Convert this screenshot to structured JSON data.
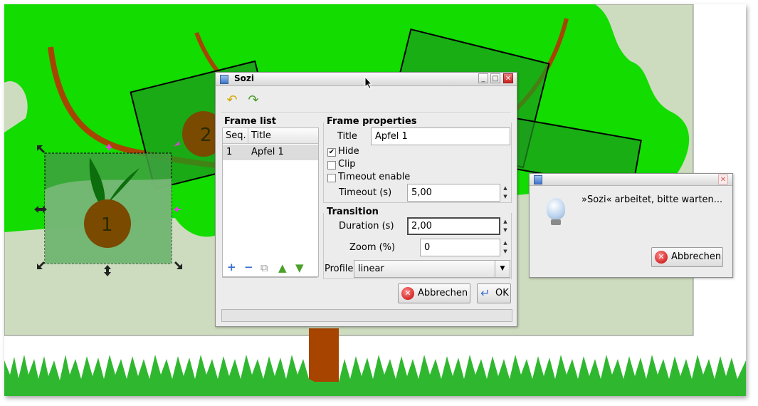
{
  "scene": {
    "frame_numbers": [
      "1",
      "2"
    ]
  },
  "sozi": {
    "title": "Sozi",
    "win_minimize": "_",
    "win_maximize": "□",
    "win_close": "✕",
    "toolbar": {
      "undo_icon": "↶",
      "redo_icon": "↷"
    },
    "frame_list": {
      "title": "Frame list",
      "col_seq": "Seq.",
      "col_title": "Title",
      "rows": [
        {
          "seq": "1",
          "title": "Apfel 1"
        }
      ],
      "add": "+",
      "remove": "−",
      "duplicate": "⧉",
      "up": "▲",
      "down": "▼"
    },
    "frame_properties": {
      "title": "Frame properties",
      "title_label": "Title",
      "title_value": "Apfel 1",
      "hide_label": "Hide",
      "hide_checked": "✔",
      "clip_label": "Clip",
      "timeout_enable_label": "Timeout enable",
      "timeout_label": "Timeout (s)",
      "timeout_value": "5,00"
    },
    "transition": {
      "title": "Transition",
      "duration_label": "Duration (s)",
      "duration_value": "2,00",
      "zoom_label": "Zoom (%)",
      "zoom_value": "0",
      "profile_label": "Profile",
      "profile_value": "linear"
    },
    "cancel_label": "Abbrechen",
    "ok_label": "OK",
    "spin_up": "▲",
    "spin_down": "▼",
    "dropdown_arrow": "▼"
  },
  "progress": {
    "message": "»Sozi« arbeitet, bitte warten...",
    "cancel_label": "Abbrechen",
    "close": "✕"
  },
  "colors": {
    "foliage": "#12dc00",
    "trunk": "#a64400",
    "background_panel": "#cddcbe",
    "frame_fill": "#2e8b2e",
    "grass": "#2fb82f"
  }
}
